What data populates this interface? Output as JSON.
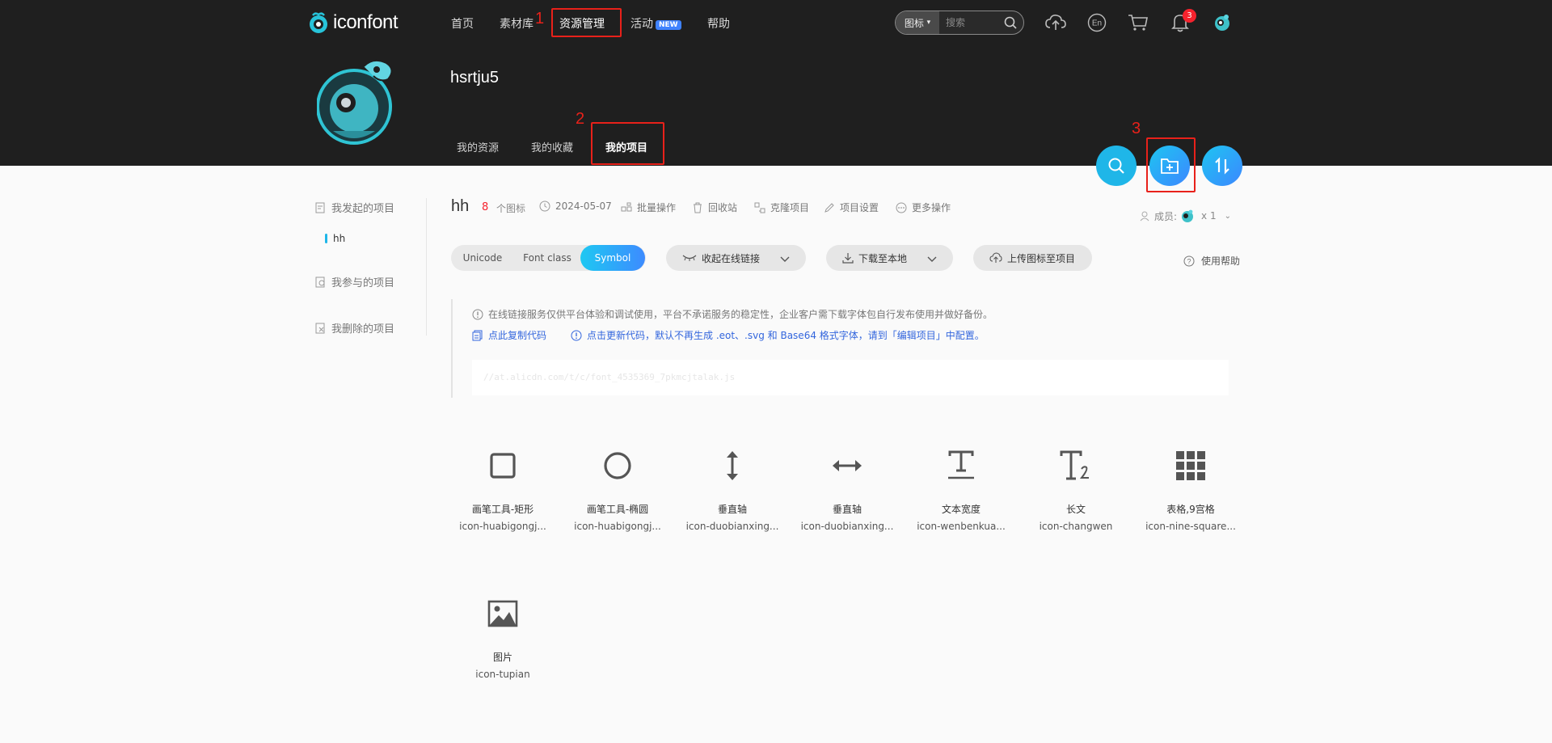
{
  "nav": {
    "logo_text": "iconfont",
    "items": [
      {
        "label": "首页"
      },
      {
        "label": "素材库"
      },
      {
        "label": "资源管理"
      },
      {
        "label": "活动"
      },
      {
        "label": "帮助"
      }
    ],
    "new_badge": "NEW",
    "search_type": "图标",
    "search_placeholder": "搜索",
    "lang_label": "En",
    "notifications": "3"
  },
  "annotations": {
    "n1": "1",
    "n2": "2",
    "n3": "3"
  },
  "profile": {
    "username": "hsrtju5",
    "tabs": [
      {
        "label": "我的资源"
      },
      {
        "label": "我的收藏"
      },
      {
        "label": "我的项目"
      }
    ]
  },
  "sidebar": {
    "started": "我发起的项目",
    "project": "hh",
    "joined": "我参与的项目",
    "deleted": "我删除的项目"
  },
  "project": {
    "name": "hh",
    "count": "8",
    "count_unit": "个图标",
    "date": "2024-05-07",
    "actions": {
      "batch": "批量操作",
      "recycle": "回收站",
      "clone": "克隆项目",
      "settings": "项目设置",
      "more": "更多操作"
    },
    "members_label": "成员:",
    "members_count": "x 1"
  },
  "formats": {
    "options": [
      "Unicode",
      "Font class",
      "Symbol"
    ],
    "selected": "Symbol"
  },
  "buttons": {
    "collapse_link": "收起在线链接",
    "download": "下载至本地",
    "upload": "上传图标至项目",
    "help": "使用帮助"
  },
  "notice": {
    "line1": "在线链接服务仅供平台体验和调试使用，平台不承诺服务的稳定性，企业客户需下载字体包自行发布使用并做好备份。",
    "copy_code": "点此复制代码",
    "update_code": "点击更新代码，默认不再生成 .eot、.svg 和 Base64 格式字体，请到「编辑项目」中配置。",
    "code_url": "//at.alicdn.com/t/c/font_4535369_7pkmcjtalak.js"
  },
  "icons": [
    {
      "name": "画笔工具-矩形",
      "code": "icon-huabigongj...",
      "glyph": "square-icon"
    },
    {
      "name": "画笔工具-椭圆",
      "code": "icon-huabigongj...",
      "glyph": "circle-icon"
    },
    {
      "name": "垂直轴",
      "code": "icon-duobianxing...",
      "glyph": "vertical-arrow-icon"
    },
    {
      "name": "垂直轴",
      "code": "icon-duobianxing...",
      "glyph": "horizontal-arrow-icon"
    },
    {
      "name": "文本宽度",
      "code": "icon-wenbenkua...",
      "glyph": "text-width-icon"
    },
    {
      "name": "长文",
      "code": "icon-changwen",
      "glyph": "long-text-icon"
    },
    {
      "name": "表格,9宫格",
      "code": "icon-nine-square...",
      "glyph": "nine-square-icon"
    },
    {
      "name": "图片",
      "code": "icon-tupian",
      "glyph": "image-icon"
    }
  ],
  "colors": {
    "header_bg": "#1f1f1f",
    "accent": "#1fb6e8",
    "annotation_red": "#e8211a",
    "page_bg": "#fafafa"
  }
}
